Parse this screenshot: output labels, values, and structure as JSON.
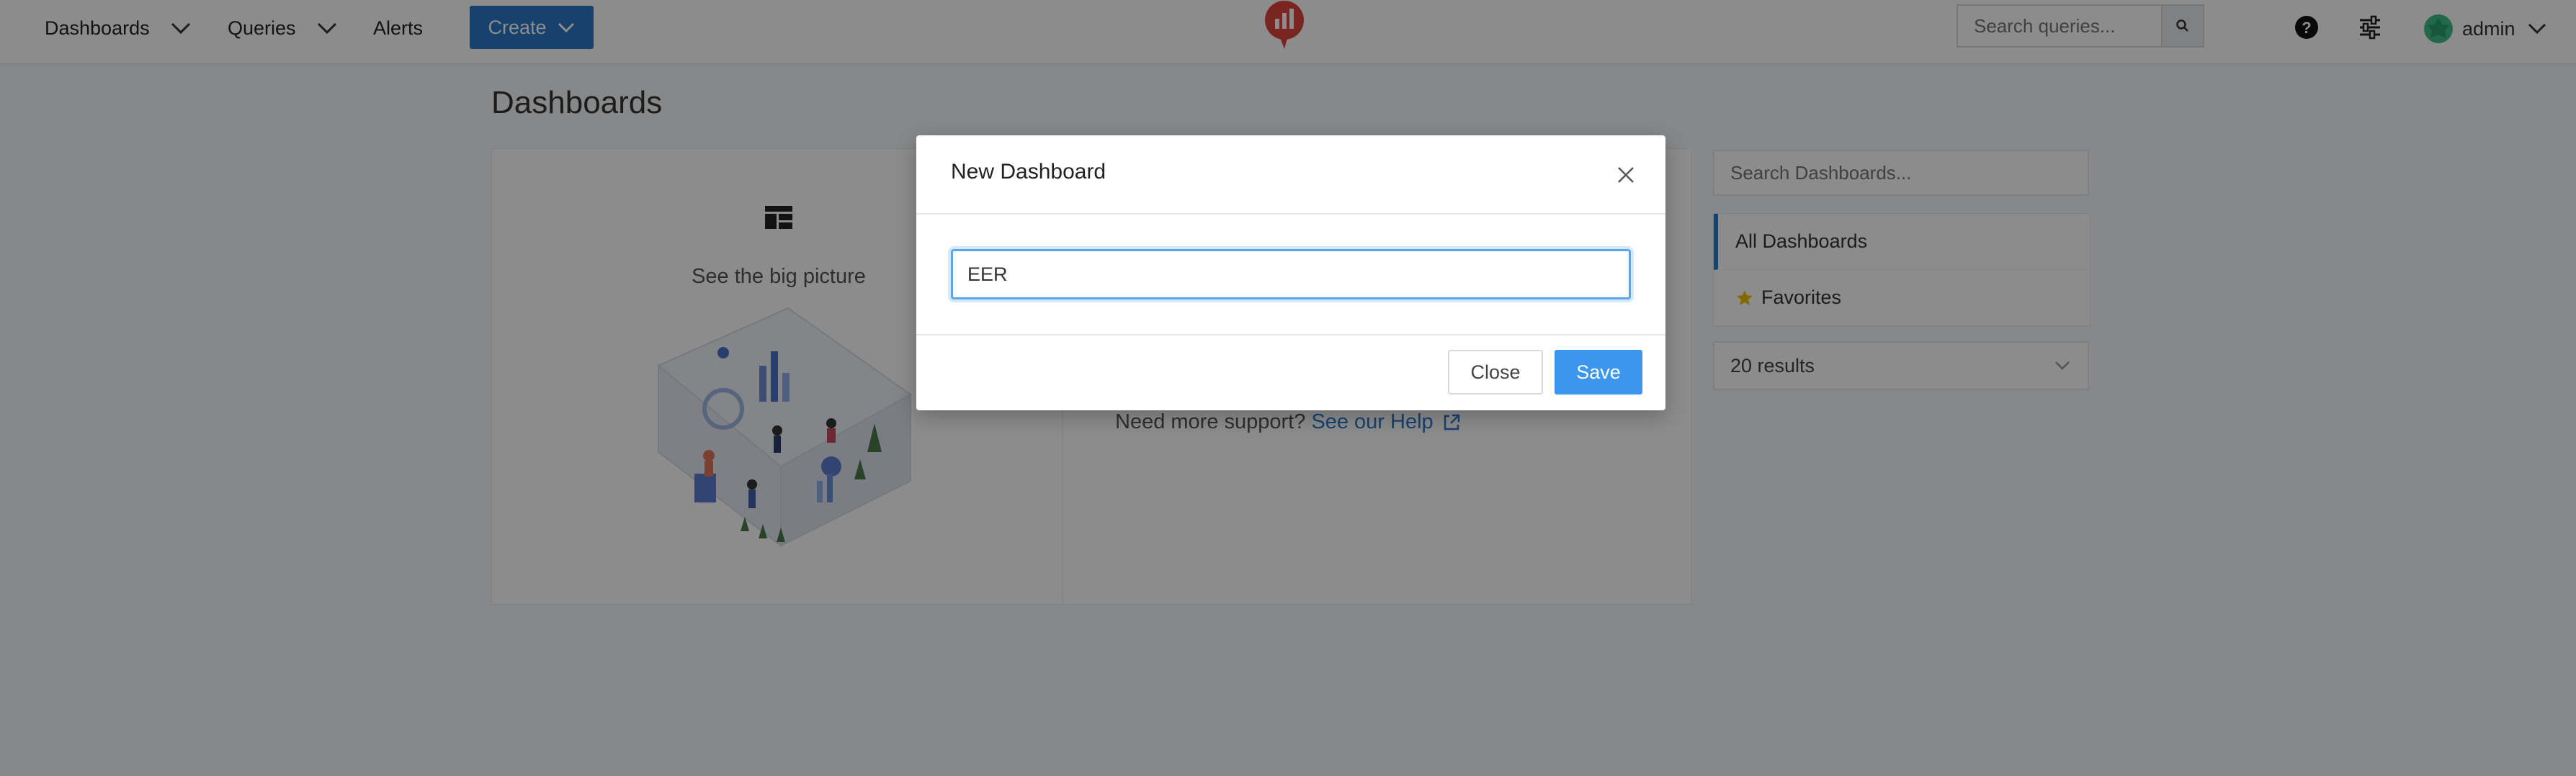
{
  "nav": {
    "dashboards": "Dashboards",
    "queries": "Queries",
    "alerts": "Alerts",
    "create": "Create",
    "search_placeholder": "Search queries...",
    "user": "admin"
  },
  "page": {
    "title": "Dashboards",
    "feature_text": "See the big picture",
    "support_text": "Need more support?",
    "help_link": "See our Help"
  },
  "sidebar": {
    "search_placeholder": "Search Dashboards...",
    "items": [
      {
        "label": "All Dashboards",
        "active": true
      },
      {
        "label": "Favorites",
        "icon": "star-icon"
      }
    ],
    "results": "20 results"
  },
  "modal": {
    "title": "New Dashboard",
    "input_value": "EER",
    "close_label": "Close",
    "save_label": "Save"
  },
  "colors": {
    "accent": "#2a79c9",
    "save": "#3c96ee",
    "logo": "#e0443c",
    "star": "#f0c000"
  }
}
